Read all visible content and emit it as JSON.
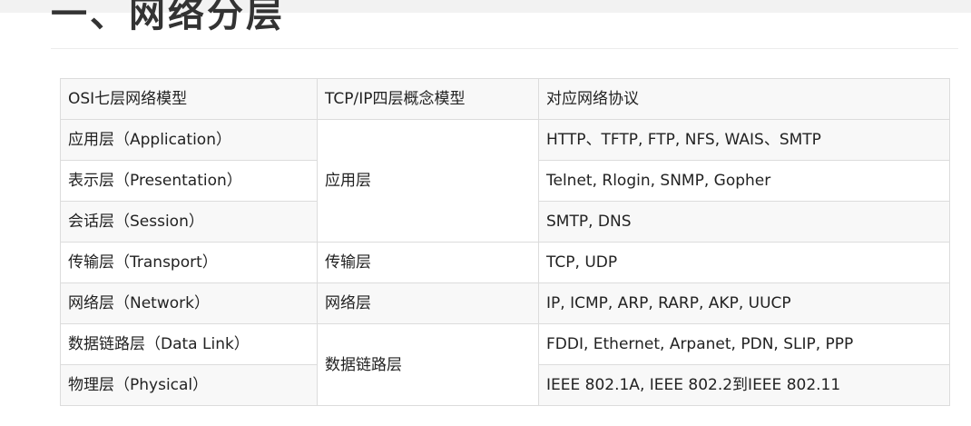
{
  "title": "一、网络分层",
  "table": {
    "headers": [
      "OSI七层网络模型",
      "TCP/IP四层概念模型",
      "对应网络协议"
    ],
    "osi": [
      "应用层（Application）",
      "表示层（Presentation）",
      "会话层（Session）",
      "传输层（Transport）",
      "网络层（Network）",
      "数据链路层（Data Link）",
      "物理层（Physical）"
    ],
    "tcpip": [
      "应用层",
      "传输层",
      "网络层",
      "数据链路层"
    ],
    "protocols": [
      "HTTP、TFTP, FTP, NFS, WAIS、SMTP",
      "Telnet, Rlogin, SNMP, Gopher",
      "SMTP, DNS",
      "TCP, UDP",
      "IP, ICMP, ARP, RARP, AKP, UUCP",
      "FDDI, Ethernet, Arpanet, PDN, SLIP, PPP",
      "IEEE 802.1A, IEEE 802.2到IEEE 802.11"
    ]
  }
}
